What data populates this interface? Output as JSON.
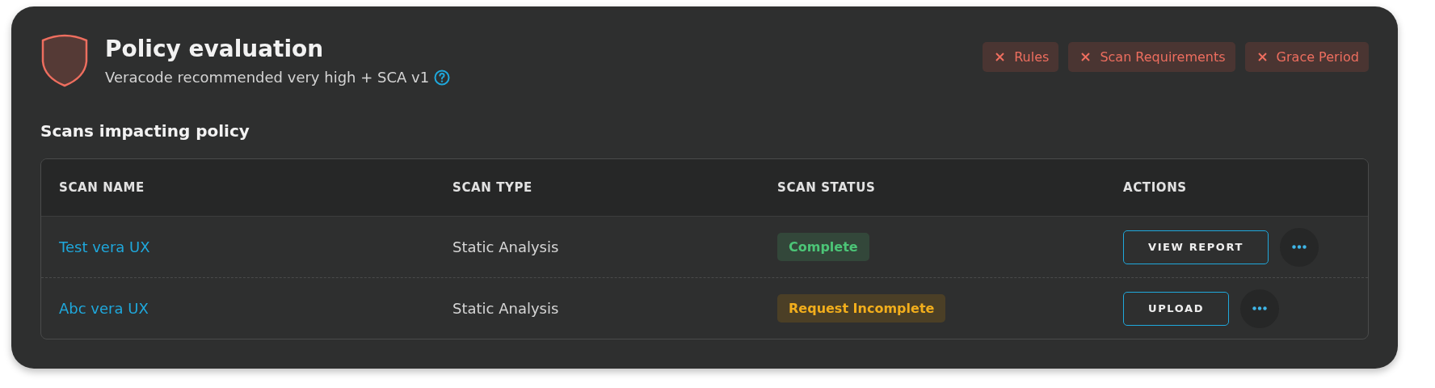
{
  "header": {
    "title": "Policy evaluation",
    "subtitle": "Veracode recommended very high + SCA v1",
    "kind": "failed"
  },
  "failed_checks": [
    {
      "label": "Rules"
    },
    {
      "label": "Scan Requirements"
    },
    {
      "label": "Grace Period"
    }
  ],
  "section_title": "Scans impacting policy",
  "table": {
    "columns": [
      "SCAN NAME",
      "SCAN TYPE",
      "SCAN STATUS",
      "ACTIONS"
    ],
    "rows": [
      {
        "name": "Test vera UX",
        "type": "Static Analysis",
        "status": {
          "label": "Complete",
          "kind": "success"
        },
        "action": "VIEW REPORT"
      },
      {
        "name": "Abc vera UX",
        "type": "Static Analysis",
        "status": {
          "label": "Request Incomplete",
          "kind": "warning"
        },
        "action": "UPLOAD"
      }
    ]
  }
}
